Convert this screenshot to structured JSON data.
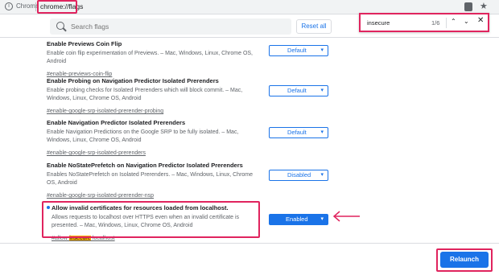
{
  "topbar": {
    "info_icon": "info-icon",
    "browser_label": "Chrome",
    "url": "chrome://flags"
  },
  "search": {
    "placeholder": "Search flags",
    "reset_label": "Reset all"
  },
  "find": {
    "query": "insecure",
    "count": "1/6"
  },
  "flags": [
    {
      "title": "Enable Previews Coin Flip",
      "desc": "Enable coin flip experimentation of Previews. – Mac, Windows, Linux, Chrome OS, Android",
      "link": "#enable-previews-coin-flip",
      "value": "Default"
    },
    {
      "title": "Enable Probing on Navigation Predictor Isolated Prerenders",
      "desc": "Enable probing checks for Isolated Prerenders which will block commit. – Mac, Windows, Linux, Chrome OS, Android",
      "link": "#enable-google-srp-isolated-prerender-probing",
      "value": "Default"
    },
    {
      "title": "Enable Navigation Predictor Isolated Prerenders",
      "desc": "Enable Navigation Predictions on the Google SRP to be fully isolated. – Mac, Windows, Linux, Chrome OS, Android",
      "link": "#enable-google-srp-isolated-prerenders",
      "value": "Default"
    },
    {
      "title": "Enable NoStatePrefetch on Navigation Predictor Isolated Prerenders",
      "desc": "Enables NoStatePrefetch on Isolated Prerenders. – Mac, Windows, Linux, Chrome OS, Android",
      "link": "#enable-google-srp-isolated-prerender-nsp",
      "value": "Disabled"
    },
    {
      "title": "Allow invalid certificates for resources loaded from localhost.",
      "desc": "Allows requests to localhost over HTTPS even when an invalid certificate is presented. – Mac, Windows, Linux, Chrome OS, Android",
      "link_pre": "#allow-",
      "link_hl": "insecure",
      "link_post": "-localhost",
      "value": "Enabled"
    }
  ],
  "relaunch_label": "Relaunch",
  "colors": {
    "accent": "#1a73e8",
    "highlight_box": "#e0245e",
    "find_match": "#f9ab00"
  }
}
